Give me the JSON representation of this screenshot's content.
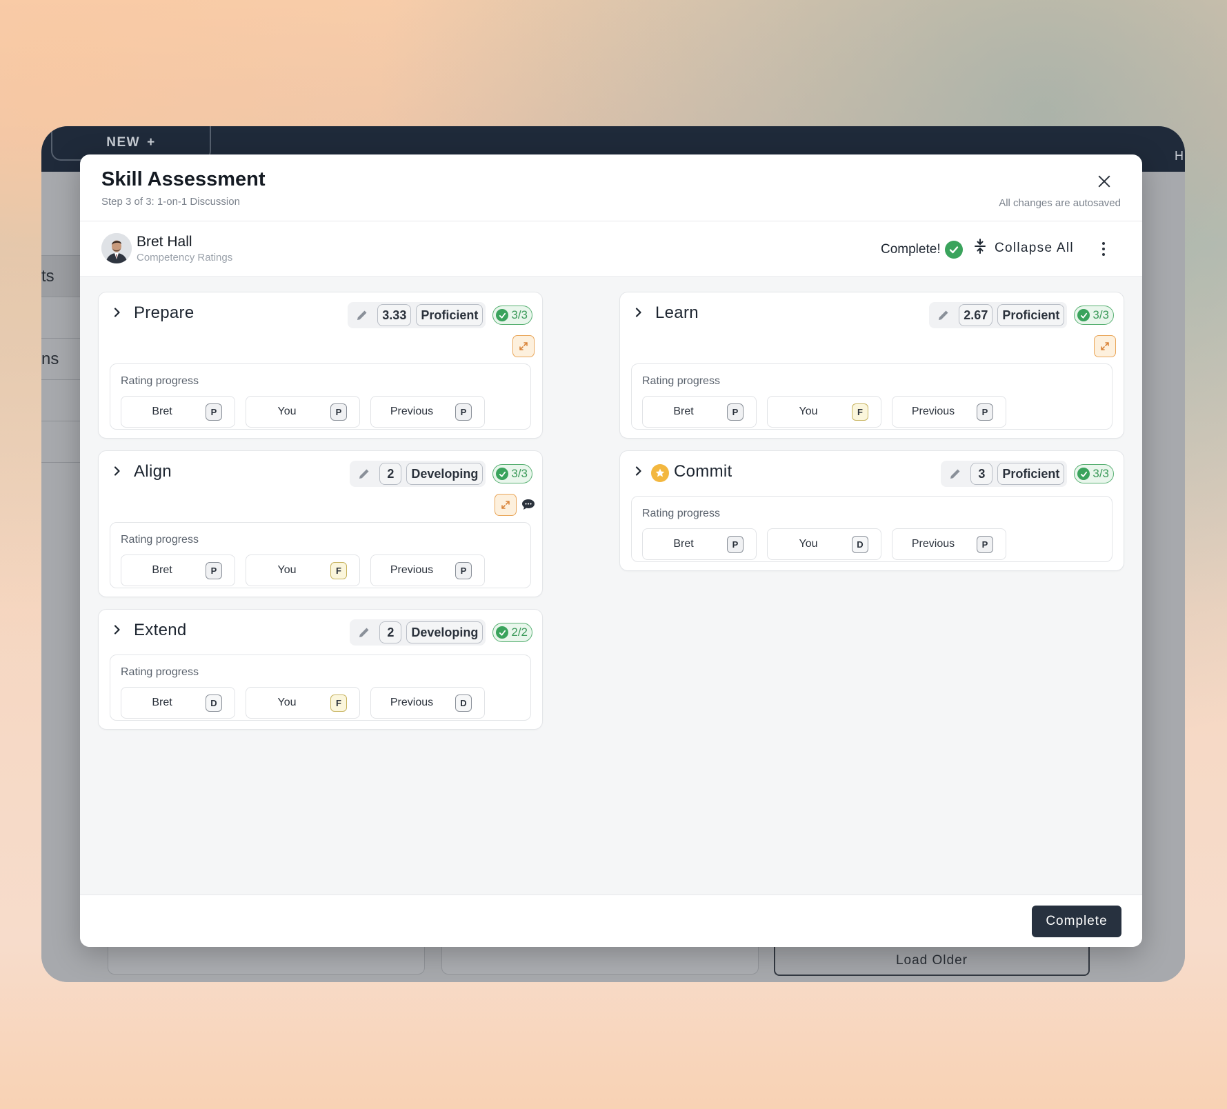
{
  "app": {
    "new_tab": "NEW",
    "corner": "H",
    "side_fragments": [
      "ts",
      "ns"
    ],
    "load_older": "Load Older"
  },
  "modal": {
    "title": "Skill Assessment",
    "subtitle": "Step 3 of 3: 1-on-1 Discussion",
    "autosave": "All changes are autosaved",
    "complete_button": "Complete"
  },
  "user": {
    "name": "Bret Hall",
    "role": "Competency Ratings",
    "status": "Complete!",
    "collapse_all": "Collapse All"
  },
  "rating_progress_label": "Rating progress",
  "competencies": [
    {
      "title": "Prepare",
      "score": "3.33",
      "level": "Proficient",
      "count": "3/3",
      "ratings": [
        {
          "who": "Bret",
          "tag": "P"
        },
        {
          "who": "You",
          "tag": "P"
        },
        {
          "who": "Previous",
          "tag": "P"
        }
      ]
    },
    {
      "title": "Align",
      "score": "2",
      "level": "Developing",
      "count": "3/3",
      "ratings": [
        {
          "who": "Bret",
          "tag": "P"
        },
        {
          "who": "You",
          "tag": "F"
        },
        {
          "who": "Previous",
          "tag": "P"
        }
      ]
    },
    {
      "title": "Extend",
      "score": "2",
      "level": "Developing",
      "count": "2/2",
      "ratings": [
        {
          "who": "Bret",
          "tag": "D"
        },
        {
          "who": "You",
          "tag": "F"
        },
        {
          "who": "Previous",
          "tag": "D"
        }
      ]
    },
    {
      "title": "Learn",
      "score": "2.67",
      "level": "Proficient",
      "count": "3/3",
      "ratings": [
        {
          "who": "Bret",
          "tag": "P"
        },
        {
          "who": "You",
          "tag": "F"
        },
        {
          "who": "Previous",
          "tag": "P"
        }
      ]
    },
    {
      "title": "Commit",
      "score": "3",
      "level": "Proficient",
      "count": "3/3",
      "ratings": [
        {
          "who": "Bret",
          "tag": "P"
        },
        {
          "who": "You",
          "tag": "D"
        },
        {
          "who": "Previous",
          "tag": "P"
        }
      ]
    }
  ],
  "colors": {
    "accent_dark": "#27313f",
    "success": "#3aa35c",
    "expand_orange": "#e9a65a",
    "star_gold": "#f3b73f"
  },
  "icons": [
    "close-icon",
    "check-circle-icon",
    "collapse-all-icon",
    "kebab-menu-icon",
    "chevron-right-icon",
    "pencil-icon",
    "expand-icon",
    "comment-icon",
    "star-icon"
  ]
}
